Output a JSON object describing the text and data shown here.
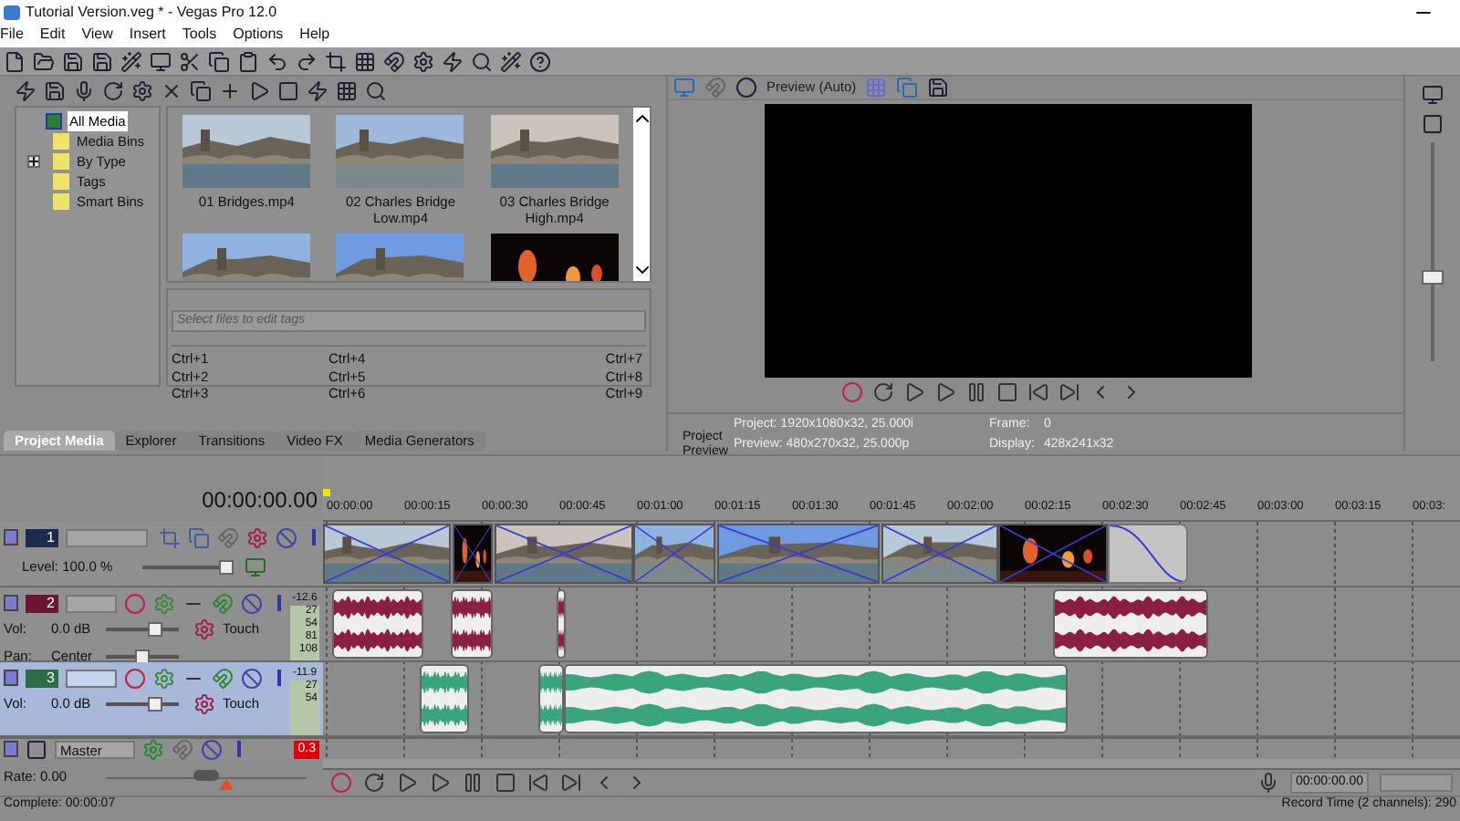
{
  "window": {
    "title": "Tutorial Version.veg * - Vegas Pro 12.0"
  },
  "menu": [
    "File",
    "Edit",
    "View",
    "Insert",
    "Tools",
    "Options",
    "Help"
  ],
  "media_tree": [
    {
      "label": "All Media",
      "selected": true,
      "children": [
        {
          "label": "Media Bins",
          "selected": false
        },
        {
          "label": "By Type",
          "selected": false,
          "expanded": false
        },
        {
          "label": "Tags",
          "selected": false
        },
        {
          "label": "Smart Bins",
          "selected": false
        }
      ]
    }
  ],
  "media": [
    {
      "kind": "file",
      "name": "01 Bridges.mp4"
    },
    {
      "kind": "file",
      "name": "02 Charles Bridge Low.mp4"
    },
    {
      "kind": "file",
      "name": "03 Charles Bridge High.mp4"
    },
    {
      "kind": "picture"
    },
    {
      "kind": "picture"
    },
    {
      "kind": "picture"
    }
  ],
  "tags_field": {
    "placeholder": "Select files to edit tags"
  },
  "shortcuts": [
    "Ctrl+1",
    "Ctrl+2",
    "Ctrl+3",
    "Ctrl+4",
    "Ctrl+5",
    "Ctrl+6",
    "Ctrl+7",
    "Ctrl+8",
    "Ctrl+9"
  ],
  "dock_tabs": [
    {
      "label": "Project Media",
      "selected": true
    },
    {
      "label": "Explorer",
      "selected": false
    },
    {
      "label": "Transitions",
      "selected": false
    },
    {
      "label": "Video FX",
      "selected": false
    },
    {
      "label": "Media Generators",
      "selected": false
    }
  ],
  "preview_dock_tab": {
    "label": "Project Preview"
  },
  "preview": {
    "mode": "Preview (Auto)",
    "project": "Project: 1920x1080x32, 25.000i",
    "preview": "Preview: 480x270x32, 25.000p",
    "frame_label": "Frame:",
    "frame": "0",
    "display_label": "Display:",
    "display": "428x241x32"
  },
  "timeline": {
    "time": "00:00:00.00",
    "ruler": [
      "00:00:00",
      "00:00:15",
      "00:00:30",
      "00:00:45",
      "00:01:00",
      "00:01:15",
      "00:01:30",
      "00:01:45",
      "00:02:00",
      "00:02:15",
      "00:02:30",
      "00:02:45",
      "00:03:00",
      "00:03:15",
      "00:03:"
    ]
  },
  "tracks": [
    {
      "kind": "video",
      "number": "1",
      "color": "#1c2b4d",
      "selected": false,
      "level_label": "Level: 100.0 %",
      "level": 1.0
    },
    {
      "kind": "audio",
      "number": "2",
      "color": "#6a1631",
      "selected": false,
      "vol_label": "Vol:",
      "vol": "0.0 dB",
      "level": 0.72,
      "mode": "Touch",
      "pan": {
        "label": "Pan:",
        "value": "Center",
        "level": 0.5
      },
      "peak": "-12.6",
      "scale": [
        "27",
        "54",
        "81",
        "108"
      ]
    },
    {
      "kind": "audio",
      "number": "3",
      "color": "#2e6b47",
      "selected": true,
      "vol_label": "Vol:",
      "vol": "0.0 dB",
      "level": 0.72,
      "mode": "Touch",
      "peak": "-11.9",
      "scale": [
        "27",
        "54"
      ]
    }
  ],
  "master": {
    "name": "Master",
    "peak": "0.3"
  },
  "rate": {
    "label": "Rate: 0.00",
    "level": 0.5
  },
  "transport_time": "00:00:00.00",
  "status": {
    "complete": "Complete: 00:00:07",
    "record": "Record Time (2 channels): 290"
  }
}
